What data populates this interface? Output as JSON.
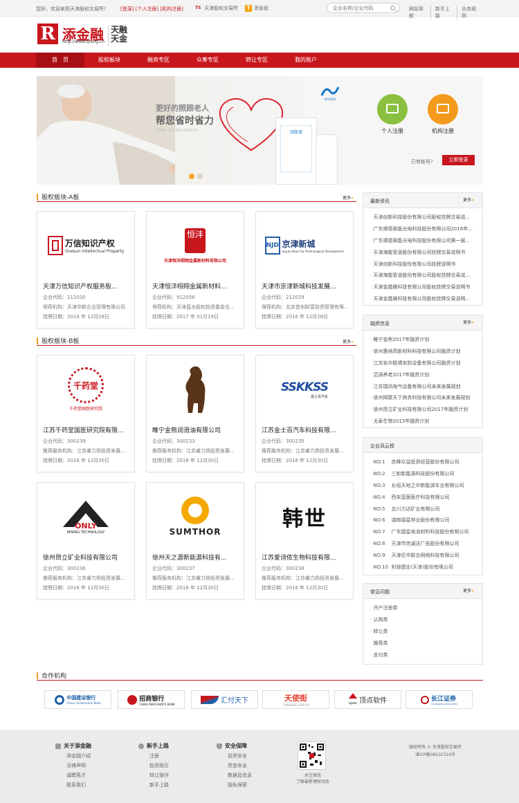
{
  "topbar": {
    "greeting": "您好，欢迎来到天津股权交易所！",
    "links": "[登录] [个人注册] [机构注册]",
    "site1_icon": "TS",
    "site1": "天津股权交易所",
    "site2_icon": "T",
    "site2": "添金投",
    "search_placeholder": "企业名称/企业代码",
    "right_links": [
      "网站导航",
      "新手上路",
      "业务规则"
    ]
  },
  "logo": {
    "mark": "R",
    "name": "添金融",
    "url": "http://www.tjrong.cn",
    "tj_line1": "天融",
    "tj_line2": "天金"
  },
  "nav": [
    "首　页",
    "股权板块",
    "融资专区",
    "众筹专区",
    "转让专区",
    "我的账户"
  ],
  "banner": {
    "line1": "更好的照顾老人",
    "line2": "帮您省时省力",
    "line3": "Cater for the elderly",
    "brand": "SPONGE",
    "product": "润肤液"
  },
  "register": {
    "personal": "个人注册",
    "org": "机构注册",
    "has_account": "已有帐号？",
    "login": "立即登录"
  },
  "section_a": {
    "title": "股权板块-A板",
    "more": "更多",
    "cards": [
      {
        "logo_text": "万信知识产权",
        "logo_sub": "Onesun Intellectual Property",
        "name": "天津万信知识产权服务股...",
        "code": "企业代码：212030",
        "org": "保荐机构：天津华新企业管理有限公司",
        "date": "挂牌日期：2016 年 12月28日"
      },
      {
        "logo_text": "天津恒沣栩翔金属新材料有限公司",
        "logo_sub": "恒沣",
        "name": "天津恒沣栩翔金属新材料...",
        "code": "企业代码：912056",
        "org": "保荐机构：天津蓝水股权投资基金合...",
        "date": "挂牌日期：2017 年 01月19日"
      },
      {
        "logo_text": "京津新城",
        "logo_sub": "Jing Jin New City Technological Development",
        "name": "天津市京津新城科技发展...",
        "code": "企业代码：212029",
        "org": "保荐机构：北京首创财富投资管理有限公司",
        "date": "挂牌日期：2016 年 12月28日"
      }
    ]
  },
  "section_b": {
    "title": "股权板块-B板",
    "more": "更多",
    "cards": [
      {
        "logo_text": "千药堂",
        "logo_sub": "千药堂国医研究院",
        "name": "江苏千药堂国医研究院有限...",
        "code": "企业代码：300239",
        "org": "推荐服务机构：江苏睿力扬投资发展...",
        "date": "挂牌日期：2016 年 12月30日"
      },
      {
        "logo_text": "熊",
        "logo_sub": "",
        "name": "睢宁金熊润滑油有限公司",
        "code": "企业代码：300233",
        "org": "推荐服务机构：江苏睿力扬投资发展...",
        "date": "挂牌日期：2016 年 12月30日"
      },
      {
        "logo_text": "SSKKSS",
        "logo_sub": "金士百汽车",
        "name": "江苏金士百汽车科技有限...",
        "code": "企业代码：300235",
        "org": "推荐服务机构：江苏睿力扬投资发展...",
        "date": "挂牌日期：2016 年 12月30日"
      },
      {
        "logo_text": "ONLY",
        "logo_sub": "MINING TECHNOLOGY",
        "name": "徐州昂立矿业科技有限公司",
        "code": "企业代码：300236",
        "org": "推荐服务机构：江苏睿力扬投资发展...",
        "date": "挂牌日期：2016 年 12月30日"
      },
      {
        "logo_text": "SUMTHOR",
        "logo_sub": "",
        "name": "徐州天之源新能源科技有...",
        "code": "企业代码：300237",
        "org": "推荐服务机构：江苏睿力扬投资发展...",
        "date": "挂牌日期：2016 年 12月30日"
      },
      {
        "logo_text": "韩世",
        "logo_sub": "",
        "name": "江苏爱诗侬生物科技有限...",
        "code": "企业代码：300238",
        "org": "推荐服务机构：江苏睿力扬投资发展...",
        "date": "挂牌日期：2016 年 12月30日"
      }
    ]
  },
  "news": {
    "title": "最新资讯",
    "more": "更多",
    "items": [
      "天津创新科技股份有限公司股权挂牌交易说...",
      "广东顺德奥能光电科技股份有限公司2016年...",
      "广东顺德奥能光电科技股份有限公司第一届...",
      "天津海能管道股份有限公司挂牌交易说明书",
      "天津创新科技股份有限公司挂牌说明书",
      "天津海能管道股份有限公司股权挂牌交易说...",
      "天津金霞晨科技有限公司股权挂牌交易说明书",
      "天津金霞晨科技有限公司股权挂牌交易说明..."
    ]
  },
  "finance": {
    "title": "融资信息",
    "more": "更多",
    "items": [
      "睢宁金熊2017年融资计划",
      "徐州惠纳高新材料科技有限公司融资计划",
      "江苏安中联顺安防设备有限公司融资计划",
      "范源养老2017年融资计划",
      "江苏瑞风电气设备有限公司未来发展规划",
      "徐州网聚天下商务科技有限公司未来发展规划",
      "徐州昂立矿业科技有限公司2017年融资计划",
      "尤泰生物2015年融资计划"
    ]
  },
  "ranking": {
    "title": "企业风云榜",
    "items": [
      {
        "no": "NO.1",
        "name": "赤峰众益投资经营股份有限公司"
      },
      {
        "no": "NO.2",
        "name": "三和新能源科技股份有限公司"
      },
      {
        "no": "NO.3",
        "name": "长垣天地之中新能源车业有限公司"
      },
      {
        "no": "NO.4",
        "name": "西安蓝茵医疗科技有限公司"
      },
      {
        "no": "NO.5",
        "name": "北川力达矿业有限公司"
      },
      {
        "no": "NO.6",
        "name": "湖南福星林业股份有限公司"
      },
      {
        "no": "NO.7",
        "name": "广东捷星电池材料科技股份有限公司"
      },
      {
        "no": "NO.8",
        "name": "天津市信诚达广告股份有限公司"
      },
      {
        "no": "NO.9",
        "name": "天津巨华联合网络科技有限公司"
      },
      {
        "no": "NO.10",
        "name": "利锁盟业(天津)股份有限公司"
      }
    ]
  },
  "faq": {
    "title": "常见问题",
    "more": "更多",
    "items": [
      "开户注册类",
      "认购类",
      "转让类",
      "推荐类",
      "支付类"
    ]
  },
  "partners": {
    "title": "合作机构",
    "items": [
      {
        "cn": "中国建设银行",
        "en": "China Construction Bank",
        "color": "#1f5fa6"
      },
      {
        "cn": "招商银行",
        "en": "CHINA MERCHANTS BANK",
        "color": "#c8161d"
      },
      {
        "cn": "汇付天下",
        "en": "",
        "color": "#1f5fa6"
      },
      {
        "cn": "天使街",
        "en": "TIANSHIJIE.COM.CN",
        "color": "#e23c2c"
      },
      {
        "cn": "顶点软件",
        "en": "apex",
        "color": "#333333"
      },
      {
        "cn": "长江证券",
        "en": "CHANGJIANG SECURITIES",
        "color": "#1f5fa6"
      }
    ]
  },
  "footer": {
    "about": {
      "title": "关于添金融",
      "links": [
        "添金融介绍",
        "法律声明",
        "诚聘英才",
        "联系我们"
      ]
    },
    "guide": {
      "title": "新手上路",
      "links": [
        "注册",
        "投资指引",
        "转让操作",
        "新手上路"
      ]
    },
    "safe": {
      "title": "安全保障",
      "links": [
        "投资安全",
        "资金安全",
        "数据及信息",
        "隐私保密"
      ]
    },
    "qr_text1": "关注微信",
    "qr_text2": "了解最新理财动态",
    "copyright1": "版权所有 © 天津股权交易所",
    "copyright2": "津ICP备08102316号"
  },
  "colors": {
    "brand_red": "#c8161d",
    "accent_orange": "#f39a1e",
    "green": "#8bbf3f"
  }
}
